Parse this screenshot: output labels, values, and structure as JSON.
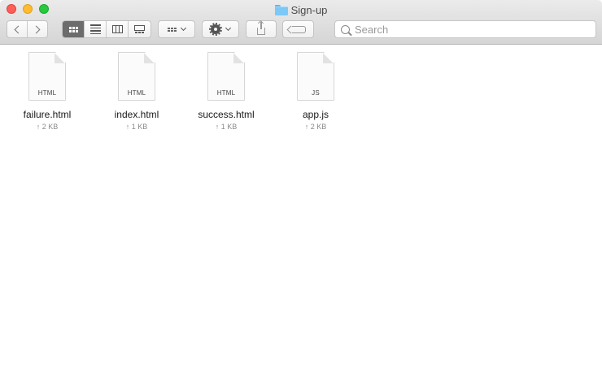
{
  "window": {
    "title": "Sign-up"
  },
  "toolbar": {
    "view_modes": [
      {
        "name": "icon-view",
        "active": true
      },
      {
        "name": "list-view",
        "active": false
      },
      {
        "name": "column-view",
        "active": false
      },
      {
        "name": "gallery-view",
        "active": false
      }
    ]
  },
  "search": {
    "placeholder": "Search",
    "value": ""
  },
  "files": [
    {
      "name": "failure.html",
      "type": "HTML",
      "size": "↑ 2 KB"
    },
    {
      "name": "index.html",
      "type": "HTML",
      "size": "↑ 1 KB"
    },
    {
      "name": "success.html",
      "type": "HTML",
      "size": "↑ 1 KB"
    },
    {
      "name": "app.js",
      "type": "JS",
      "size": "↑ 2 KB"
    }
  ],
  "colors": {
    "close": "#fd5f57",
    "minimize": "#febc2e",
    "zoom": "#28c840",
    "active_view": "#6c6c6c",
    "folder": "#7cc8f7"
  }
}
